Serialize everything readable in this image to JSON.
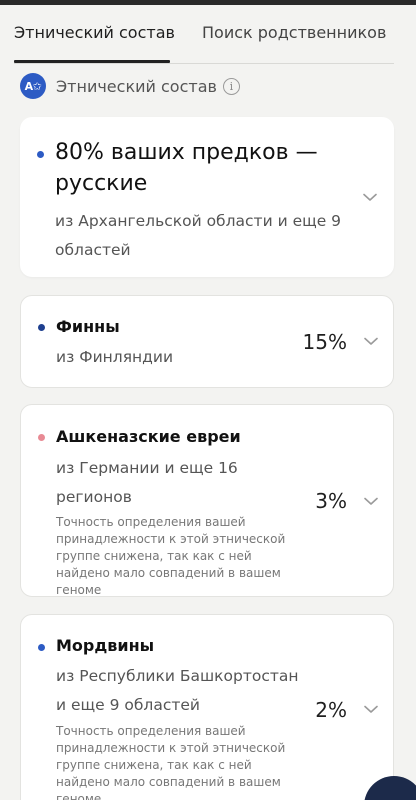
{
  "tabs": [
    {
      "label": "Этнический состав",
      "active": true
    },
    {
      "label": "Поиск родственников",
      "active": false
    }
  ],
  "section": {
    "badge": "A✩",
    "title": "Этнический состав",
    "info_icon": "info-icon"
  },
  "main_card": {
    "title": "80% ваших предков — русские",
    "subtitle": "из Архангельской области и еще 9 областей",
    "dot_color": "#2d5bc4"
  },
  "ethnicities": [
    {
      "name": "Финны",
      "origin": "из Финляндии",
      "percent": "15%",
      "note": "",
      "dot_color": "#1e3f8f"
    },
    {
      "name": "Ашкеназские евреи",
      "origin": "из Германии и еще 16 регионов",
      "percent": "3%",
      "note": "Точность определения вашей принадлежности к этой этнической группе снижена, так как с ней найдено мало совпадений в вашем геноме",
      "dot_color": "#e88a94"
    },
    {
      "name": "Мордвины",
      "origin": "из Республики Башкортостан и еще 9 областей",
      "percent": "2%",
      "note": "Точность определения вашей принадлежности к этой этнической группе снижена, так как с ней найдено мало совпадений в вашем геноме",
      "dot_color": "#2d5bc4"
    }
  ],
  "colors": {
    "accent": "#2d5bc4",
    "background": "#f3f3f1",
    "card": "#ffffff"
  }
}
